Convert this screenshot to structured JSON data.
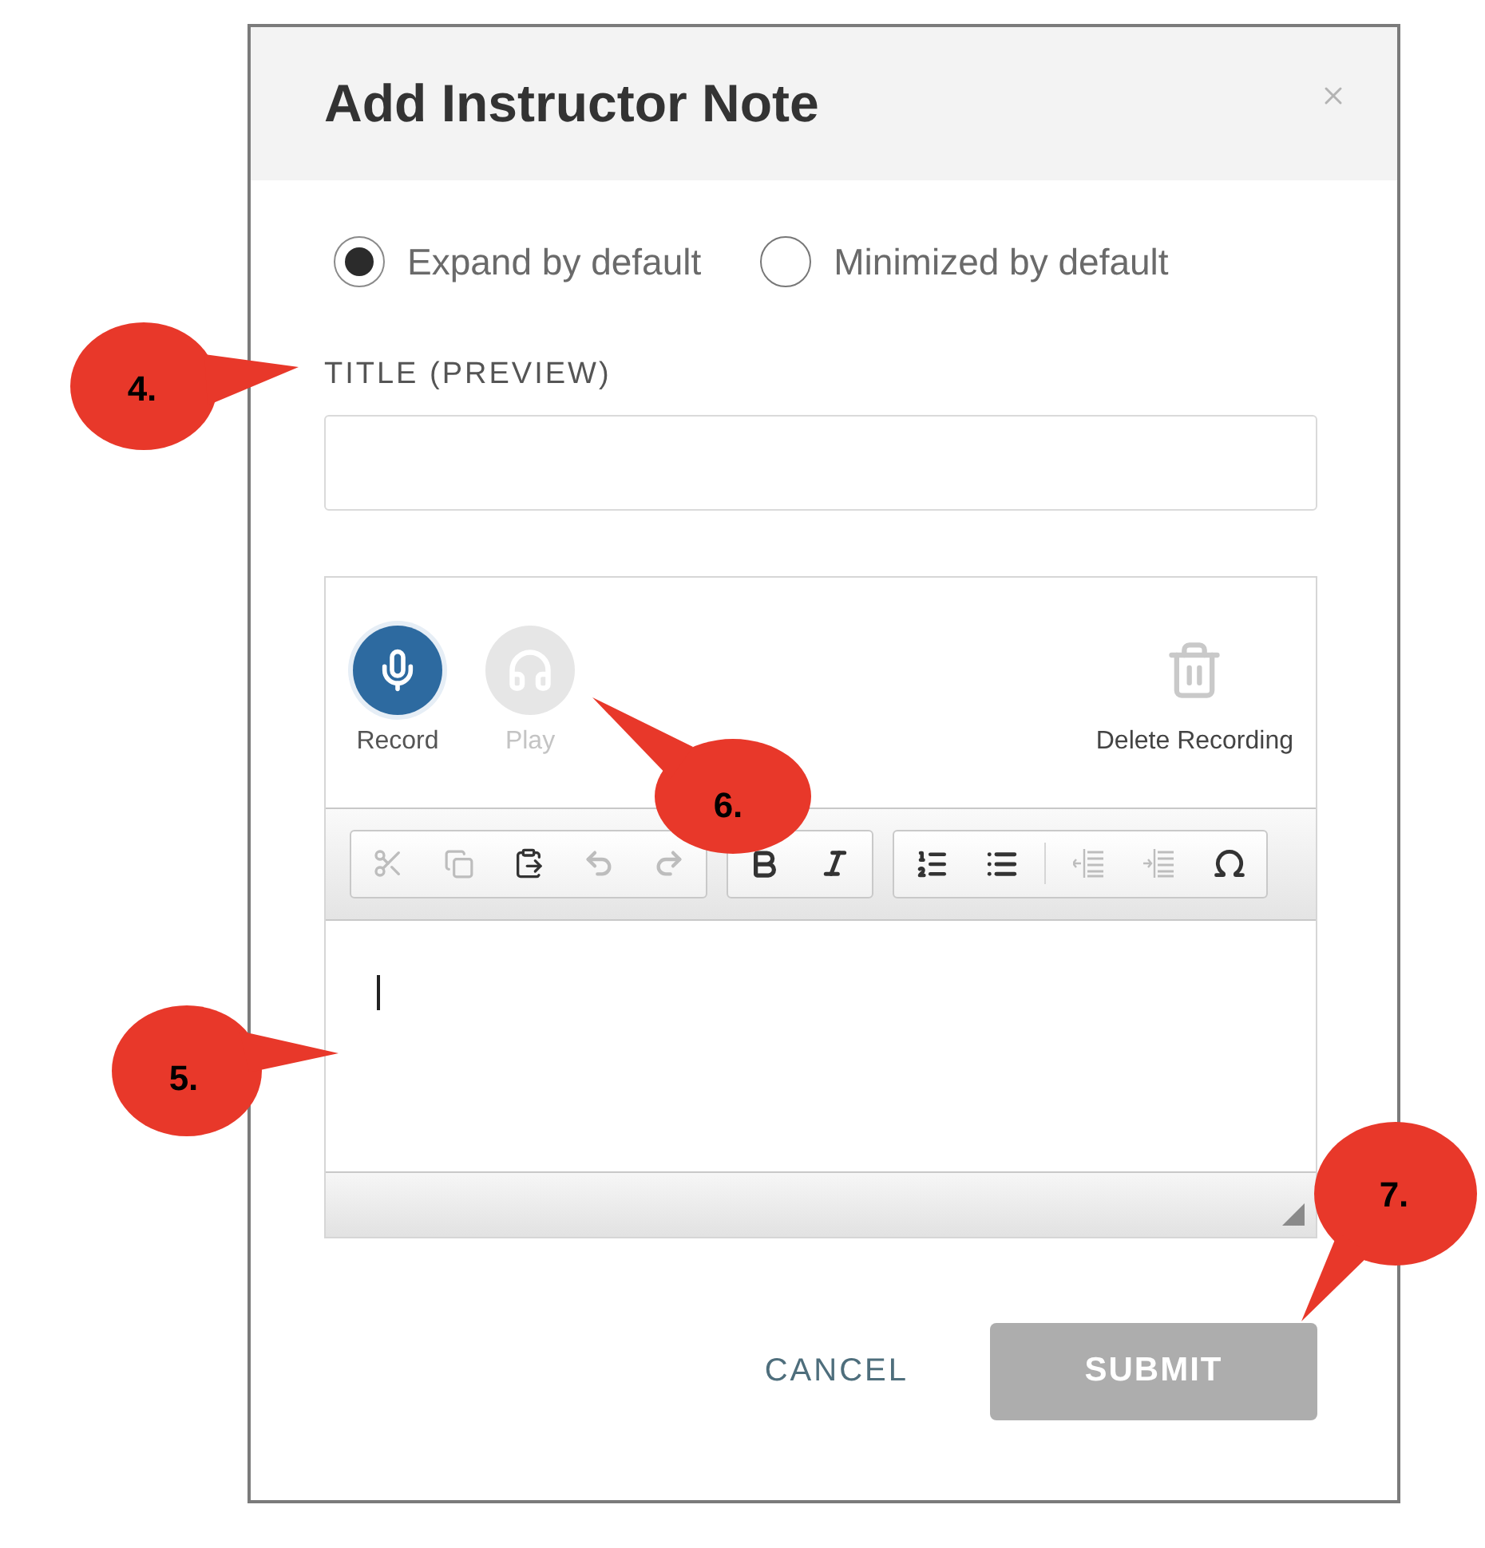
{
  "dialog": {
    "title": "Add Instructor Note"
  },
  "display_options": [
    {
      "label": "Expand by default",
      "selected": true
    },
    {
      "label": "Minimized by default",
      "selected": false
    }
  ],
  "title_field": {
    "label": "TITLE (PREVIEW)"
  },
  "recorder": {
    "actions": [
      {
        "kind": "record",
        "label": "Record",
        "disabled": false
      },
      {
        "kind": "play",
        "label": "Play",
        "disabled": true
      }
    ],
    "delete": {
      "label": "Delete Recording"
    }
  },
  "editor_toolbar": {
    "groups": [
      {
        "tools": [
          {
            "kind": "cut",
            "disabled": true
          },
          {
            "kind": "copy",
            "disabled": true
          },
          {
            "kind": "paste",
            "disabled": false
          },
          {
            "kind": "undo",
            "disabled": true
          },
          {
            "kind": "redo",
            "disabled": true
          }
        ]
      },
      {
        "tools": [
          {
            "kind": "bold",
            "disabled": false
          },
          {
            "kind": "italic",
            "disabled": false
          }
        ]
      },
      {
        "tools": [
          {
            "kind": "numbered_list",
            "disabled": false
          },
          {
            "kind": "bulleted_list",
            "disabled": false
          },
          {
            "kind": "separator"
          },
          {
            "kind": "outdent",
            "disabled": true
          },
          {
            "kind": "indent",
            "disabled": true
          },
          {
            "kind": "special_character",
            "disabled": false
          }
        ]
      }
    ]
  },
  "editor": {
    "focused": true
  },
  "buttons": [
    {
      "kind": "cancel",
      "label": "CANCEL",
      "disabled": false
    },
    {
      "kind": "submit",
      "label": "SUBMIT",
      "disabled": true
    }
  ],
  "annotations": [
    {
      "label": "4."
    },
    {
      "label": "5."
    },
    {
      "label": "6."
    },
    {
      "label": "7."
    }
  ]
}
